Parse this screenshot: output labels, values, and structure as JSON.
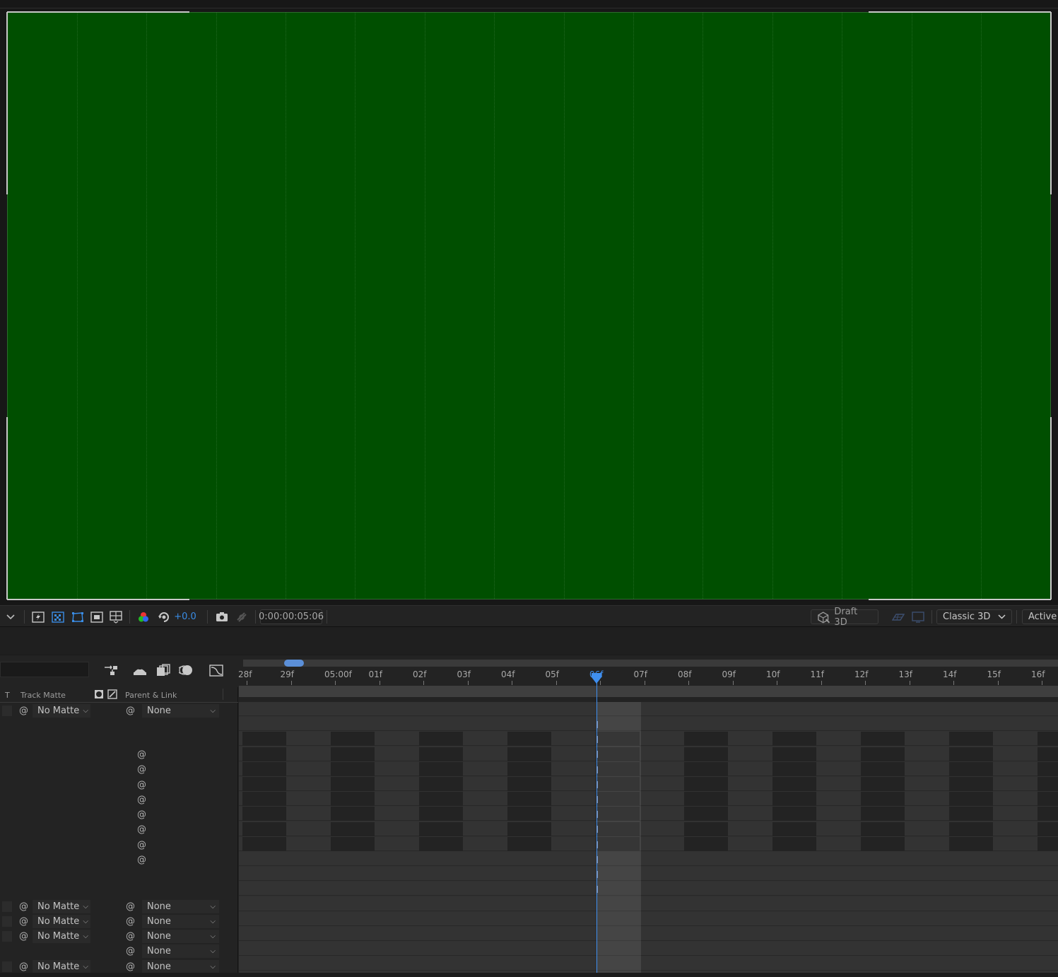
{
  "viewer_toolbar": {
    "exposure_value": "+0.0",
    "timecode": "0:00:00:05:06",
    "renderer_label": "Draft 3D",
    "renderer_mode": "Classic 3D",
    "view_label": "Active"
  },
  "timeline": {
    "columns": {
      "toggle_label": "T",
      "track_matte_label": "Track Matte",
      "parent_link_label": "Parent & Link"
    },
    "ruler_labels": [
      "28f",
      "29f",
      "05:00f",
      "01f",
      "02f",
      "03f",
      "04f",
      "05f",
      "06f",
      "07f",
      "08f",
      "09f",
      "10f",
      "11f",
      "12f",
      "13f",
      "14f",
      "15f",
      "16f"
    ],
    "layers": [
      {
        "matte": "No Matte",
        "parent": "None"
      },
      {
        "matte": "No Matte",
        "parent": "None"
      },
      {
        "matte": "No Matte",
        "parent": "None"
      },
      {
        "matte": "No Matte",
        "parent": "None"
      },
      {
        "matte": "",
        "parent": "None"
      },
      {
        "matte": "No Matte",
        "parent": "None"
      }
    ]
  },
  "colors": {
    "canvas": "#004f00",
    "playhead": "#3f8ff0",
    "cache_blue": "#1f2fa8",
    "cache_green": "#2fb52f"
  }
}
